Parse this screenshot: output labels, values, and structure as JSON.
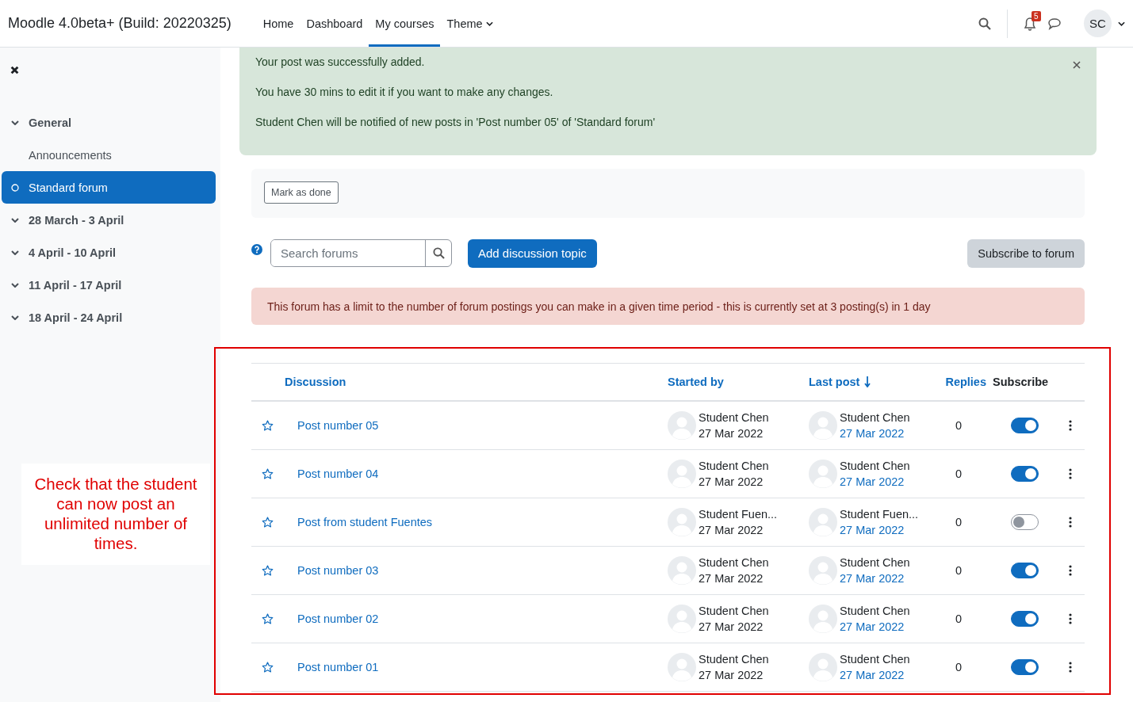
{
  "header": {
    "site_name": "Moodle 4.0beta+ (Build: 20220325)",
    "nav": [
      {
        "label": "Home",
        "selected": false,
        "dropdown": false
      },
      {
        "label": "Dashboard",
        "selected": false,
        "dropdown": false
      },
      {
        "label": "My courses",
        "selected": true,
        "dropdown": false
      },
      {
        "label": "Theme",
        "selected": false,
        "dropdown": true
      }
    ],
    "notification_count": "5",
    "avatar_initials": "SC"
  },
  "sidebar": {
    "items": [
      {
        "label": "General",
        "kind": "section",
        "selected": false
      },
      {
        "label": "Announcements",
        "kind": "activity",
        "selected": false
      },
      {
        "label": "Standard forum",
        "kind": "activity",
        "selected": true
      },
      {
        "label": "28 March - 3 April",
        "kind": "section",
        "selected": false
      },
      {
        "label": "4 April - 10 April",
        "kind": "section",
        "selected": false
      },
      {
        "label": "11 April - 17 April",
        "kind": "section",
        "selected": false
      },
      {
        "label": "18 April - 24 April",
        "kind": "section",
        "selected": false
      }
    ]
  },
  "success_alert": {
    "lines": [
      "Your post was successfully added.",
      "You have 30 mins to edit it if you want to make any changes.",
      "Student Chen will be notified of new posts in 'Post number 05' of 'Standard forum'"
    ]
  },
  "mark_done_button": "Mark as done",
  "search": {
    "placeholder": "Search forums"
  },
  "add_topic_button": "Add discussion topic",
  "subscribe_button": "Subscribe to forum",
  "limit_alert": "This forum has a limit to the number of forum postings you can make in a given time period - this is currently set at 3 posting(s) in 1 day",
  "table": {
    "columns": [
      "Discussion",
      "Started by",
      "Last post",
      "Replies",
      "Subscribe"
    ],
    "rows": [
      {
        "discussion": "Post number 05",
        "started_by": "Student Chen",
        "started_date": "27 Mar 2022",
        "last_post_by": "Student Chen",
        "last_post_date": "27 Mar 2022",
        "replies": "0",
        "subscribed": true
      },
      {
        "discussion": "Post number 04",
        "started_by": "Student Chen",
        "started_date": "27 Mar 2022",
        "last_post_by": "Student Chen",
        "last_post_date": "27 Mar 2022",
        "replies": "0",
        "subscribed": true
      },
      {
        "discussion": "Post from student Fuentes",
        "started_by": "Student Fuen...",
        "started_date": "27 Mar 2022",
        "last_post_by": "Student Fuen...",
        "last_post_date": "27 Mar 2022",
        "replies": "0",
        "subscribed": false
      },
      {
        "discussion": "Post number 03",
        "started_by": "Student Chen",
        "started_date": "27 Mar 2022",
        "last_post_by": "Student Chen",
        "last_post_date": "27 Mar 2022",
        "replies": "0",
        "subscribed": true
      },
      {
        "discussion": "Post number 02",
        "started_by": "Student Chen",
        "started_date": "27 Mar 2022",
        "last_post_by": "Student Chen",
        "last_post_date": "27 Mar 2022",
        "replies": "0",
        "subscribed": true
      },
      {
        "discussion": "Post number 01",
        "started_by": "Student Chen",
        "started_date": "27 Mar 2022",
        "last_post_by": "Student Chen",
        "last_post_date": "27 Mar 2022",
        "replies": "0",
        "subscribed": true
      }
    ]
  },
  "annotation": {
    "text": "Check that the student can now post an unlimited number of times."
  }
}
